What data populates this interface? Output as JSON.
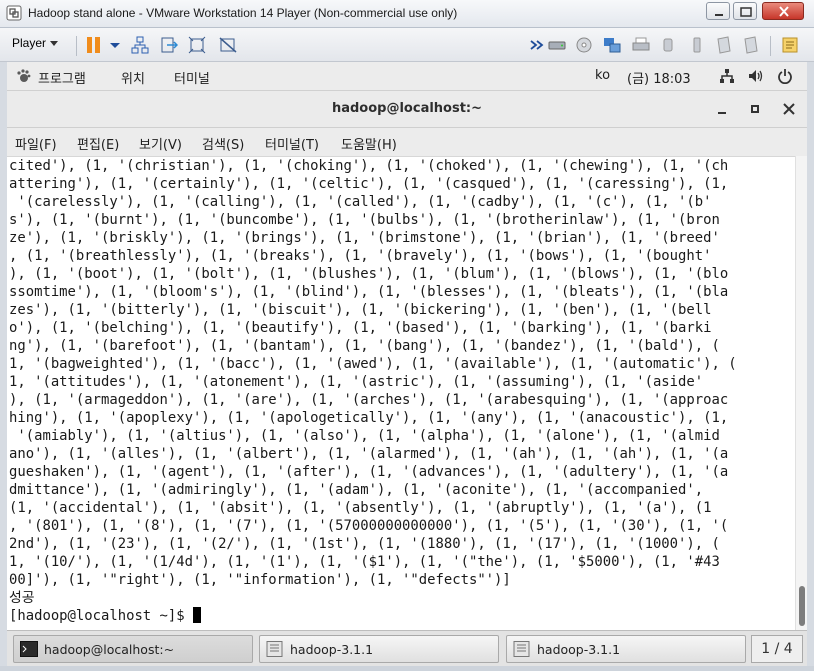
{
  "vm_window": {
    "title": "Hadoop stand alone - VMware Workstation 14 Player (Non-commercial use only)",
    "controls": [
      "minimize-icon",
      "restore-icon",
      "close-icon"
    ]
  },
  "vm_toolbar": {
    "player_menu_label": "Player",
    "left_icons": [
      "pause-icon",
      "dropdown-caret-icon",
      "network-icon",
      "send-ctrl-alt-del-icon",
      "fullscreen-icon",
      "unity-icon"
    ],
    "right_icons": [
      "more-icon",
      "hard-disk-icon",
      "cd-icon",
      "network-adapter-icon",
      "printer-icon",
      "sound-icon",
      "usb-icon",
      "floppy-icon",
      "display-icon",
      "message-log-icon"
    ]
  },
  "gnome_bar": {
    "apps_label": "프로그램",
    "places_label": "위치",
    "terminal_label": "터미널",
    "input_method": "ko",
    "clock": "(금) 18:03"
  },
  "terminal": {
    "title": "hadoop@localhost:~",
    "menu": [
      "파일(F)",
      "편집(E)",
      "보기(V)",
      "검색(S)",
      "터미널(T)",
      "도움말(H)"
    ],
    "lines": [
      "cited'), (1, '(christian'), (1, '(choking'), (1, '(choked'), (1, '(chewing'), (1, '(ch",
      "attering'), (1, '(certainly'), (1, '(celtic'), (1, '(casqued'), (1, '(caressing'), (1,",
      " '(carelessly'), (1, '(calling'), (1, '(called'), (1, '(cadby'), (1, '(c'), (1, '(b'",
      "s'), (1, '(burnt'), (1, '(buncombe'), (1, '(bulbs'), (1, '(brotherinlaw'), (1, '(bron",
      "ze'), (1, '(briskly'), (1, '(brings'), (1, '(brimstone'), (1, '(brian'), (1, '(breed'",
      ", (1, '(breathlessly'), (1, '(breaks'), (1, '(bravely'), (1, '(bows'), (1, '(bought'",
      "), (1, '(boot'), (1, '(bolt'), (1, '(blushes'), (1, '(blum'), (1, '(blows'), (1, '(blo",
      "ssomtime'), (1, '(bloom's'), (1, '(blind'), (1, '(blesses'), (1, '(bleats'), (1, '(bla",
      "zes'), (1, '(bitterly'), (1, '(biscuit'), (1, '(bickering'), (1, '(ben'), (1, '(bell",
      "o'), (1, '(belching'), (1, '(beautify'), (1, '(based'), (1, '(barking'), (1, '(barki",
      "ng'), (1, '(barefoot'), (1, '(bantam'), (1, '(bang'), (1, '(bandez'), (1, '(bald'), (",
      "1, '(bagweighted'), (1, '(bacc'), (1, '(awed'), (1, '(available'), (1, '(automatic'), (",
      "1, '(attitudes'), (1, '(atonement'), (1, '(astric'), (1, '(assuming'), (1, '(aside'",
      "), (1, '(armageddon'), (1, '(are'), (1, '(arches'), (1, '(arabesquing'), (1, '(approac",
      "hing'), (1, '(apoplexy'), (1, '(apologetically'), (1, '(any'), (1, '(anacoustic'), (1,",
      " '(amiably'), (1, '(altius'), (1, '(also'), (1, '(alpha'), (1, '(alone'), (1, '(almid",
      "ano'), (1, '(alles'), (1, '(albert'), (1, '(alarmed'), (1, '(ah'), (1, '(ah'), (1, '(a",
      "gueshaken'), (1, '(agent'), (1, '(after'), (1, '(advances'), (1, '(adultery'), (1, '(a",
      "dmittance'), (1, '(admiringly'), (1, '(adam'), (1, '(aconite'), (1, '(accompanied',",
      "(1, '(accidental'), (1, '(absit'), (1, '(absently'), (1, '(abruptly'), (1, '(a'), (1",
      ", '(801'), (1, '(8'), (1, '(7'), (1, '(57000000000000'), (1, '(5'), (1, '(30'), (1, '(",
      "2nd'), (1, '(23'), (1, '(2/'), (1, '(1st'), (1, '(1880'), (1, '(17'), (1, '(1000'), (",
      "1, '(10/'), (1, '(1/4d'), (1, '(1'), (1, '($1'), (1, '(\"the'), (1, '$5000'), (1, '#43",
      "00]'), (1, '\"right'), (1, '\"information'), (1, '\"defects\"')]",
      "성공",
      "[hadoop@localhost ~]$ "
    ]
  },
  "taskbar": {
    "items": [
      {
        "label": "hadoop@localhost:~",
        "active": true
      },
      {
        "label": "hadoop-3.1.1",
        "active": false
      },
      {
        "label": "hadoop-3.1.1",
        "active": false
      }
    ],
    "pager": "1 / 4"
  }
}
